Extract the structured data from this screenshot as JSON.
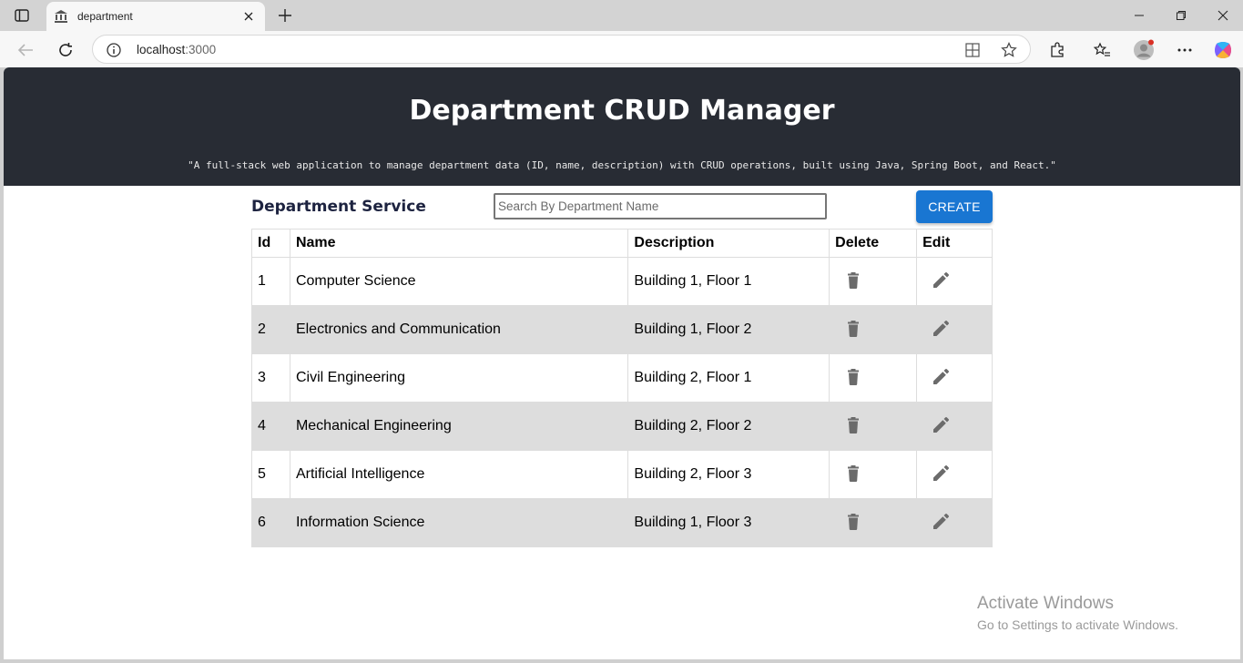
{
  "browser": {
    "tab_title": "department",
    "url_host": "localhost",
    "url_port": ":3000"
  },
  "page": {
    "title": "Department CRUD Manager",
    "subtitle": "\"A full-stack web application to manage department data (ID, name, description) with CRUD operations, built using Java, Spring Boot, and React.\"",
    "service_title": "Department Service",
    "search_placeholder": "Search By Department Name",
    "create_label": "CREATE"
  },
  "table": {
    "headers": [
      "Id",
      "Name",
      "Description",
      "Delete",
      "Edit"
    ],
    "rows": [
      {
        "id": "1",
        "name": "Computer Science",
        "description": "Building 1, Floor 1"
      },
      {
        "id": "2",
        "name": "Electronics and Communication",
        "description": "Building 1, Floor 2"
      },
      {
        "id": "3",
        "name": "Civil Engineering",
        "description": "Building 2, Floor 1"
      },
      {
        "id": "4",
        "name": "Mechanical Engineering",
        "description": "Building 2, Floor 2"
      },
      {
        "id": "5",
        "name": "Artificial Intelligence",
        "description": "Building 2, Floor 3"
      },
      {
        "id": "6",
        "name": "Information Science",
        "description": "Building 1, Floor 3"
      }
    ]
  },
  "watermark": {
    "line1": "Activate Windows",
    "line2": "Go to Settings to activate Windows."
  },
  "colors": {
    "header_bg": "#282c34",
    "button_primary": "#1976d2",
    "row_alt": "#dddddd",
    "icon_gray": "#6b6b6b"
  }
}
